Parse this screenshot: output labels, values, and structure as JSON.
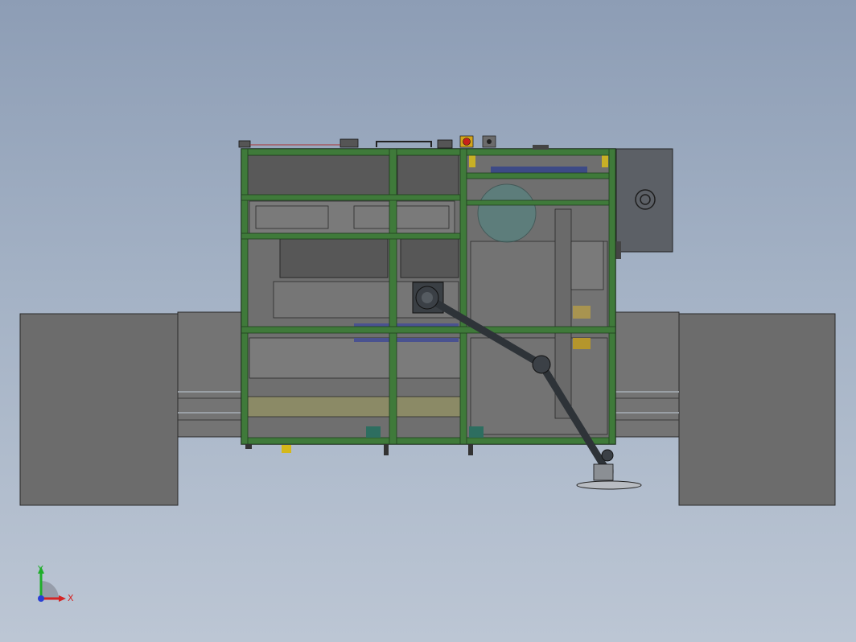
{
  "viewport": {
    "background_top": "#8d9db5",
    "background_bottom": "#bcc6d4"
  },
  "model": {
    "frame_color": "#3f7a3a",
    "frame_dark": "#234a22",
    "panel_gray": "#6f6f6f",
    "outrigger_gray": "#6c6c6c",
    "enclosure_gray": "#5c6066",
    "robot_arm_color": "#2e3338",
    "estop_color": "#c8201a"
  },
  "triad": {
    "x_label": "X",
    "y_label": "Y",
    "x_color": "#d42424",
    "y_color": "#1fae2a",
    "z_color": "#2a3fd4"
  }
}
